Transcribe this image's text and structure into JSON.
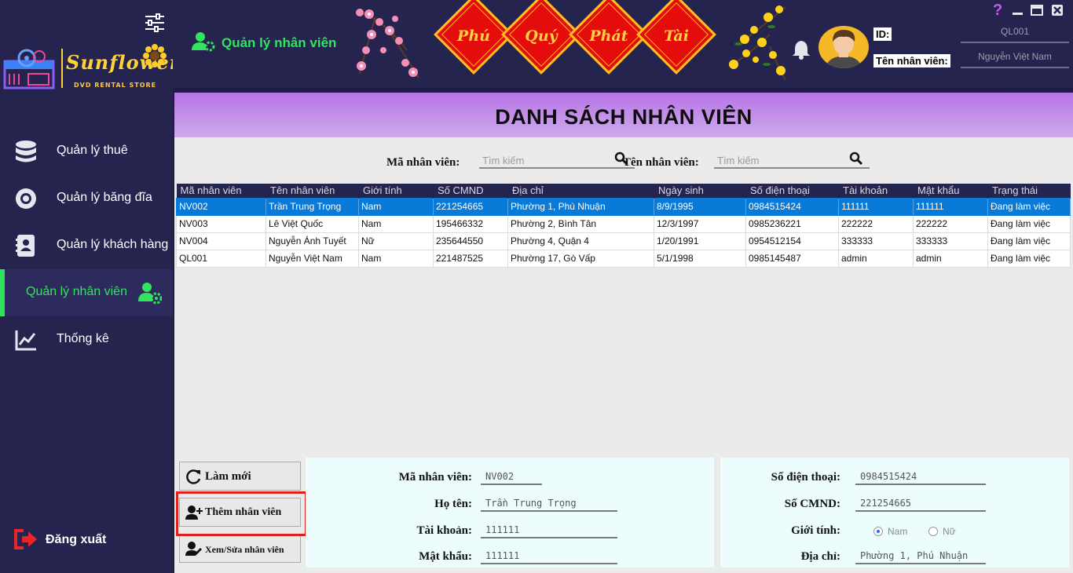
{
  "sidebar": {
    "logo": {
      "brand": "Sunflower",
      "sub": "DVD RENTAL STORE"
    },
    "items": [
      {
        "label": "Quản lý thuê",
        "icon": "database-icon"
      },
      {
        "label": "Quản lý băng đĩa",
        "icon": "disc-icon"
      },
      {
        "label": "Quản lý khách hàng",
        "icon": "contact-book-icon"
      },
      {
        "label": "Quản lý nhân viên",
        "icon": "user-gear-icon",
        "active": true
      },
      {
        "label": "Thống kê",
        "icon": "chart-line-icon"
      }
    ],
    "logout_label": "Đăng xuất"
  },
  "header": {
    "title": "Quản lý nhân viên",
    "banner": [
      "Phú",
      "Quý",
      "Phát",
      "Tài"
    ],
    "id_label": "ID:",
    "name_label": "Tên nhân viên:",
    "id_value": "QL001",
    "name_value": "Nguyễn Việt Nam",
    "help": "?"
  },
  "main": {
    "title": "DANH SÁCH NHÂN VIÊN",
    "search": {
      "code_label": "Mã nhân viên:",
      "name_label": "Tên nhân viên:",
      "code_placeholder": "Tìm kiếm",
      "name_placeholder": "Tìm kiếm"
    },
    "columns": [
      "Mã nhân viên",
      "Tên nhân viên",
      "Giới tính",
      "Số CMND",
      "Địa chỉ",
      "Ngày sinh",
      "Số điện thoại",
      "Tài khoản",
      "Mật khẩu",
      "Trạng thái"
    ],
    "rows": [
      [
        "NV002",
        "Trần Trung Trọng",
        "Nam",
        "221254665",
        "Phường 1, Phú Nhuận",
        "8/9/1995",
        "0984515424",
        "111111",
        "111111",
        "Đang làm việc"
      ],
      [
        "NV003",
        "Lê Việt Quốc",
        "Nam",
        "195466332",
        "Phường 2, Bình Tân",
        "12/3/1997",
        "0985236221",
        "222222",
        "222222",
        "Đang làm việc"
      ],
      [
        "NV004",
        "Nguyễn Ánh Tuyết",
        "Nữ",
        "235644550",
        "Phường 4, Quận 4",
        "1/20/1991",
        "0954512154",
        "333333",
        "333333",
        "Đang làm việc"
      ],
      [
        "QL001",
        "Nguyễn Việt Nam",
        "Nam",
        "221487525",
        "Phường 17, Gò Vấp",
        "5/1/1998",
        "0985145487",
        "admin",
        "admin",
        "Đang làm việc"
      ]
    ],
    "selected_row": 0,
    "buttons": {
      "refresh": "Làm mới",
      "add": "Thêm nhân viên",
      "edit": "Xem/Sửa nhân viên"
    },
    "form": {
      "code_label": "Mã nhân viên:",
      "code_value": "NV002",
      "fullname_label": "Họ tên:",
      "fullname_value": "Trần Trung Trọng",
      "account_label": "Tài khoản:",
      "account_value": "111111",
      "password_label": "Mật khẩu:",
      "password_value": "111111",
      "phone_label": "Số điện thoại:",
      "phone_value": "0984515424",
      "idcard_label": "Số CMND:",
      "idcard_value": "221254665",
      "gender_label": "Giới tính:",
      "gender_male": "Nam",
      "gender_female": "Nữ",
      "gender_selected": "Nam",
      "address_label": "Địa chỉ:",
      "address_value": "Phường 1, Phú Nhuận"
    }
  },
  "colors": {
    "sidebar_bg": "#25244f",
    "accent_green": "#32e35e",
    "title_gradient_top": "#b873e6",
    "selection_blue": "#0a7ad8",
    "highlight_red": "#e0201d"
  }
}
